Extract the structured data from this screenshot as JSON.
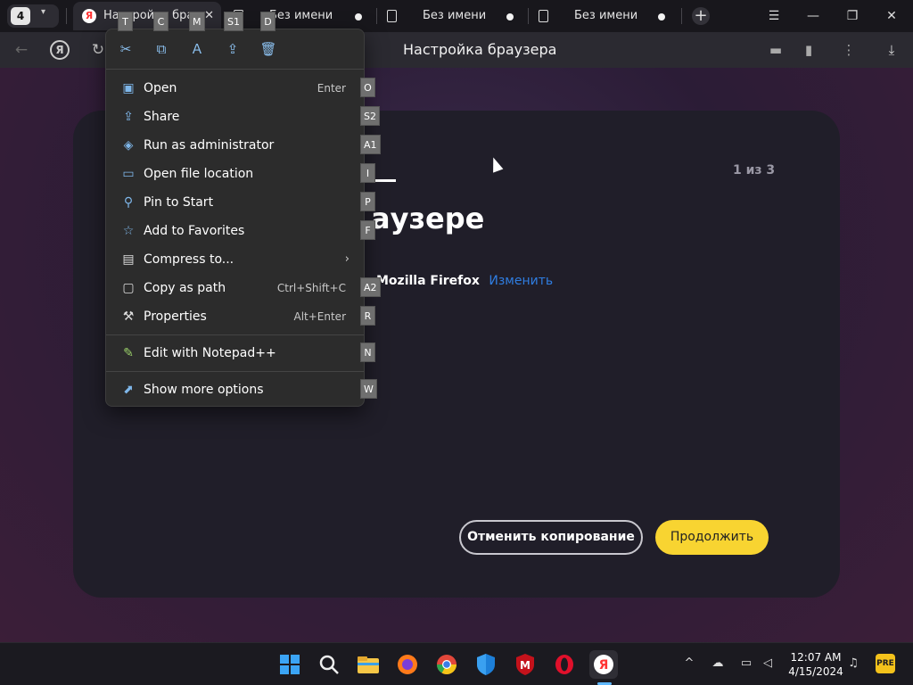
{
  "tabbar": {
    "tab_count": "4",
    "tabs": [
      {
        "title": "Настройка браузера"
      },
      {
        "title": "Без имени"
      },
      {
        "title": "Без имени"
      },
      {
        "title": "Без имени"
      }
    ]
  },
  "address_bar": {
    "page_title": "Настройка браузера"
  },
  "page": {
    "step_counter": "1 из 3",
    "headline_fragment": "аузере",
    "import_source": "Mozilla Firefox",
    "change_link": "Изменить",
    "cancel_button": "Отменить копирование",
    "continue_button": "Продолжить"
  },
  "context_menu": {
    "quick_actions": [
      {
        "icon": "cut-icon",
        "keytip": "T"
      },
      {
        "icon": "copy-icon",
        "keytip": "C"
      },
      {
        "icon": "rename-icon",
        "keytip": "M"
      },
      {
        "icon": "share-icon",
        "keytip": "S1"
      },
      {
        "icon": "delete-icon",
        "keytip": "D"
      }
    ],
    "items": [
      {
        "label": "Open",
        "shortcut": "Enter",
        "keytip": "O",
        "icon": "open-icon"
      },
      {
        "label": "Share",
        "shortcut": "",
        "keytip": "S2",
        "icon": "share-icon"
      },
      {
        "label": "Run as administrator",
        "shortcut": "",
        "keytip": "A1",
        "icon": "admin-shield-icon"
      },
      {
        "label": "Open file location",
        "shortcut": "",
        "keytip": "I",
        "icon": "folder-icon"
      },
      {
        "label": "Pin to Start",
        "shortcut": "",
        "keytip": "P",
        "icon": "pin-icon"
      },
      {
        "label": "Add to Favorites",
        "shortcut": "",
        "keytip": "F",
        "icon": "star-icon"
      },
      {
        "label": "Compress to...",
        "shortcut": "",
        "keytip": "",
        "icon": "archive-icon"
      },
      {
        "label": "Copy as path",
        "shortcut": "Ctrl+Shift+C",
        "keytip": "A2",
        "icon": "copy-path-icon"
      },
      {
        "label": "Properties",
        "shortcut": "Alt+Enter",
        "keytip": "R",
        "icon": "wrench-icon"
      },
      {
        "label": "Edit with Notepad++",
        "shortcut": "",
        "keytip": "N",
        "icon": "notepad-plus-plus-icon"
      },
      {
        "label": "Show more options",
        "shortcut": "",
        "keytip": "W",
        "icon": "more-options-icon"
      }
    ]
  },
  "taskbar": {
    "time": "12:07 AM",
    "date": "4/15/2024",
    "apps": [
      "start-icon",
      "search-icon",
      "file-explorer-icon",
      "firefox-icon",
      "chrome-icon",
      "defender-icon",
      "mcafee-icon",
      "opera-icon",
      "yandex-browser-icon"
    ]
  }
}
